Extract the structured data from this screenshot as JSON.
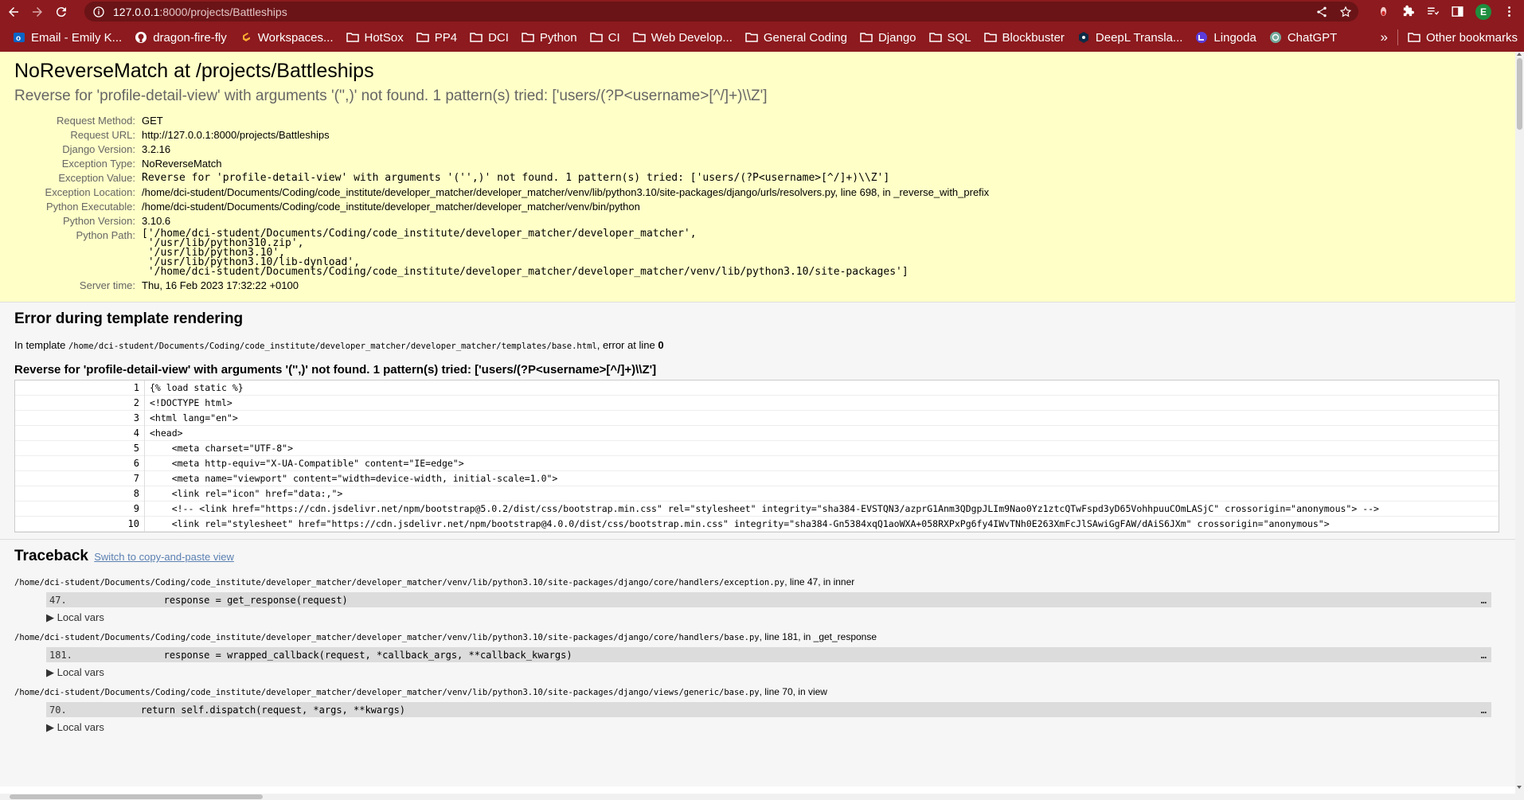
{
  "browser": {
    "url_host": "127.0.0.1",
    "url_path": ":8000/projects/Battleships",
    "profile_initial": "E",
    "bookmarks": [
      {
        "label": "Email - Emily K...",
        "icon": "outlook-icon"
      },
      {
        "label": "dragon-fire-fly",
        "icon": "github-icon"
      },
      {
        "label": "Workspaces...",
        "icon": "gitpod-icon"
      },
      {
        "label": "HotSox",
        "icon": "folder-icon"
      },
      {
        "label": "PP4",
        "icon": "folder-icon"
      },
      {
        "label": "DCI",
        "icon": "folder-icon"
      },
      {
        "label": "Python",
        "icon": "folder-icon"
      },
      {
        "label": "CI",
        "icon": "folder-icon"
      },
      {
        "label": "Web Develop...",
        "icon": "folder-icon"
      },
      {
        "label": "General Coding",
        "icon": "folder-icon"
      },
      {
        "label": "Django",
        "icon": "folder-icon"
      },
      {
        "label": "SQL",
        "icon": "folder-icon"
      },
      {
        "label": "Blockbuster",
        "icon": "folder-icon"
      },
      {
        "label": "DeepL Transla...",
        "icon": "deepl-icon"
      },
      {
        "label": "Lingoda",
        "icon": "lingoda-icon"
      },
      {
        "label": "ChatGPT",
        "icon": "chatgpt-icon"
      }
    ],
    "more_label": "»",
    "other_bookmarks": "Other bookmarks"
  },
  "summary": {
    "title": "NoReverseMatch at /projects/Battleships",
    "message": "Reverse for 'profile-detail-view' with arguments '('',)' not found. 1 pattern(s) tried: ['users/(?P<username>[^/]+)\\\\Z']",
    "rows": [
      {
        "label": "Request Method:",
        "value": "GET",
        "mono": false
      },
      {
        "label": "Request URL:",
        "value": "http://127.0.0.1:8000/projects/Battleships",
        "mono": false
      },
      {
        "label": "Django Version:",
        "value": "3.2.16",
        "mono": false
      },
      {
        "label": "Exception Type:",
        "value": "NoReverseMatch",
        "mono": false
      },
      {
        "label": "Exception Value:",
        "value": "Reverse for 'profile-detail-view' with arguments '('',)' not found. 1 pattern(s) tried: ['users/(?P<username>[^/]+)\\\\Z']",
        "mono": true
      },
      {
        "label": "Exception Location:",
        "value": "/home/dci-student/Documents/Coding/code_institute/developer_matcher/developer_matcher/venv/lib/python3.10/site-packages/django/urls/resolvers.py, line 698, in _reverse_with_prefix",
        "mono": false
      },
      {
        "label": "Python Executable:",
        "value": "/home/dci-student/Documents/Coding/code_institute/developer_matcher/developer_matcher/venv/bin/python",
        "mono": false
      },
      {
        "label": "Python Version:",
        "value": "3.10.6",
        "mono": false
      },
      {
        "label": "Python Path:",
        "value": "['/home/dci-student/Documents/Coding/code_institute/developer_matcher/developer_matcher',\n '/usr/lib/python310.zip',\n '/usr/lib/python3.10',\n '/usr/lib/python3.10/lib-dynload',\n '/home/dci-student/Documents/Coding/code_institute/developer_matcher/developer_matcher/venv/lib/python3.10/site-packages']",
        "mono": true,
        "pre": true
      },
      {
        "label": "Server time:",
        "value": "Thu, 16 Feb 2023 17:32:22 +0100",
        "mono": false
      }
    ]
  },
  "template": {
    "heading": "Error during template rendering",
    "in_template": "In template",
    "template_path": "/home/dci-student/Documents/Coding/code_institute/developer_matcher/developer_matcher/templates/base.html",
    "error_at": ", error at line",
    "error_line": "0",
    "message": "Reverse for 'profile-detail-view' with arguments '('',)' not found. 1 pattern(s) tried: ['users/(?P<username>[^/]+)\\\\Z']",
    "lines": [
      {
        "no": "1",
        "code": "{% load static %}"
      },
      {
        "no": "2",
        "code": "<!DOCTYPE html>"
      },
      {
        "no": "3",
        "code": "<html lang=\"en\">"
      },
      {
        "no": "4",
        "code": "<head>"
      },
      {
        "no": "5",
        "code": "    <meta charset=\"UTF-8\">"
      },
      {
        "no": "6",
        "code": "    <meta http-equiv=\"X-UA-Compatible\" content=\"IE=edge\">"
      },
      {
        "no": "7",
        "code": "    <meta name=\"viewport\" content=\"width=device-width, initial-scale=1.0\">"
      },
      {
        "no": "8",
        "code": "    <link rel=\"icon\" href=\"data:,\">"
      },
      {
        "no": "9",
        "code": "    <!-- <link href=\"https://cdn.jsdelivr.net/npm/bootstrap@5.0.2/dist/css/bootstrap.min.css\" rel=\"stylesheet\" integrity=\"sha384-EVSTQN3/azprG1Anm3QDgpJLIm9Nao0Yz1ztcQTwFspd3yD65VohhpuuCOmLASjC\" crossorigin=\"anonymous\"> -->"
      },
      {
        "no": "10",
        "code": "    <link rel=\"stylesheet\" href=\"https://cdn.jsdelivr.net/npm/bootstrap@4.0.0/dist/css/bootstrap.min.css\" integrity=\"sha384-Gn5384xqQ1aoWXA+058RXPxPg6fy4IWvTNh0E263XmFcJlSAwiGgFAW/dAiS6JXm\" crossorigin=\"anonymous\">"
      }
    ]
  },
  "traceback": {
    "heading": "Traceback",
    "switch_link": "Switch to copy-and-paste view",
    "frames": [
      {
        "file": "/home/dci-student/Documents/Coding/code_institute/developer_matcher/developer_matcher/venv/lib/python3.10/site-packages/django/core/handlers/exception.py",
        "where": ", line 47, in inner",
        "lineno": "47.",
        "code": "                response = get_response(request)",
        "ellipsis": "…",
        "local_vars": "▶ Local vars"
      },
      {
        "file": "/home/dci-student/Documents/Coding/code_institute/developer_matcher/developer_matcher/venv/lib/python3.10/site-packages/django/core/handlers/base.py",
        "where": ", line 181, in _get_response",
        "lineno": "181.",
        "code": "                response = wrapped_callback(request, *callback_args, **callback_kwargs)",
        "ellipsis": "…",
        "local_vars": "▶ Local vars"
      },
      {
        "file": "/home/dci-student/Documents/Coding/code_institute/developer_matcher/developer_matcher/venv/lib/python3.10/site-packages/django/views/generic/base.py",
        "where": ", line 70, in view",
        "lineno": "70.",
        "code": "            return self.dispatch(request, *args, **kwargs)",
        "ellipsis": "…",
        "local_vars": "▶ Local vars"
      }
    ]
  }
}
